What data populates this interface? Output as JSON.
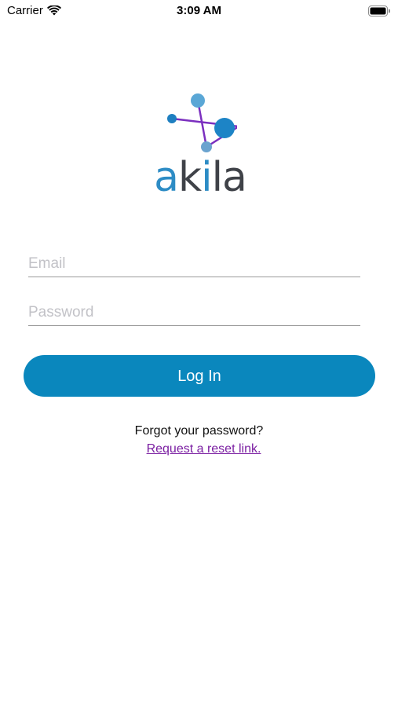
{
  "status_bar": {
    "carrier": "Carrier",
    "time": "3:09 AM"
  },
  "logo": {
    "text_a": "a",
    "text_k": "k",
    "text_i": "i",
    "text_la": "la"
  },
  "form": {
    "email_placeholder": "Email",
    "password_placeholder": "Password",
    "login_label": "Log In"
  },
  "help": {
    "forgot_text": "Forgot your password?",
    "reset_link": "Request a reset link."
  },
  "colors": {
    "primary": "#0a87bd",
    "link": "#7b1fa2",
    "logo_blue": "#2d8cc5",
    "logo_purple": "#7b2fbf"
  }
}
